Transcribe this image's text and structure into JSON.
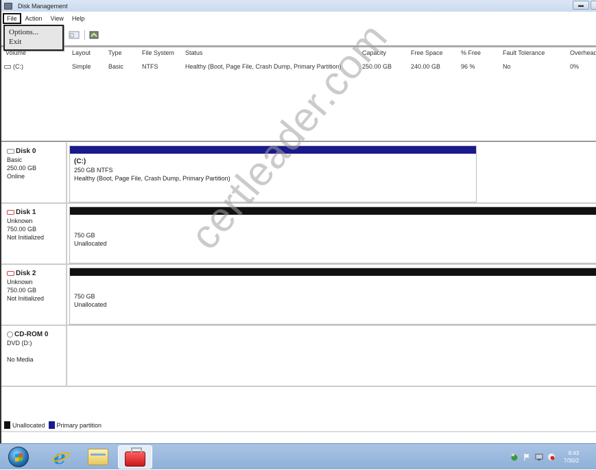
{
  "window": {
    "title": "Disk Management",
    "controls": {
      "minimize_icon": "minimize-icon",
      "maximize_icon": "maximize-icon"
    }
  },
  "menubar": {
    "items": [
      {
        "label": "File",
        "active": true
      },
      {
        "label": "Action"
      },
      {
        "label": "View"
      },
      {
        "label": "Help"
      }
    ],
    "file_menu": [
      "Options...",
      "Exit"
    ]
  },
  "toolbar": {
    "icons": [
      "back-icon",
      "forward-icon",
      "console-tree-icon",
      "refresh-icon",
      "properties-icon",
      "help-icon",
      "rescan-disks-icon"
    ]
  },
  "volume_list": {
    "columns": [
      "Volume",
      "Layout",
      "Type",
      "File System",
      "Status",
      "Capacity",
      "Free Space",
      "% Free",
      "Fault Tolerance",
      "Overhead"
    ],
    "rows": [
      {
        "volume": "(C:)",
        "layout": "Simple",
        "type": "Basic",
        "file_system": "NTFS",
        "status": "Healthy (Boot, Page File, Crash Dump, Primary Partition)",
        "capacity": "250.00 GB",
        "free_space": "240.00 GB",
        "percent_free": "96 %",
        "fault_tolerance": "No",
        "overhead": "0%"
      }
    ]
  },
  "disks": [
    {
      "name": "Disk 0",
      "type": "Basic",
      "size": "250.00 GB",
      "state": "Online",
      "partitions": [
        {
          "label": "(C:)",
          "size_fs": "250 GB NTFS",
          "status": "Healthy (Boot, Page File, Crash Dump, Primary Partition)",
          "kind": "primary"
        }
      ]
    },
    {
      "name": "Disk 1",
      "type": "Unknown",
      "size": "750.00 GB",
      "state": "Not Initialized",
      "partitions": [
        {
          "size_fs": "750 GB",
          "status": "Unallocated",
          "kind": "unallocated"
        }
      ]
    },
    {
      "name": "Disk 2",
      "type": "Unknown",
      "size": "750.00 GB",
      "state": "Not Initialized",
      "partitions": [
        {
          "size_fs": "750 GB",
          "status": "Unallocated",
          "kind": "unallocated"
        }
      ]
    },
    {
      "name": "CD-ROM 0",
      "type": "DVD (D:)",
      "size": "",
      "state": "No Media",
      "partitions": []
    }
  ],
  "legend": [
    {
      "label": "Unallocated",
      "color": "#111111"
    },
    {
      "label": "Primary partition",
      "color": "#1a1a8c"
    }
  ],
  "colors": {
    "primary_partition": "#1a1a8c",
    "unallocated": "#111111"
  },
  "taskbar": {
    "items": [
      "start-button",
      "internet-explorer",
      "windows-explorer",
      "computer-management"
    ],
    "tray_icons": [
      "security-icon",
      "action-center-flag-icon",
      "network-icon",
      "volume-icon"
    ],
    "clock_time": "8:43",
    "clock_date": "7/30/2"
  },
  "watermark": "certleader.com"
}
